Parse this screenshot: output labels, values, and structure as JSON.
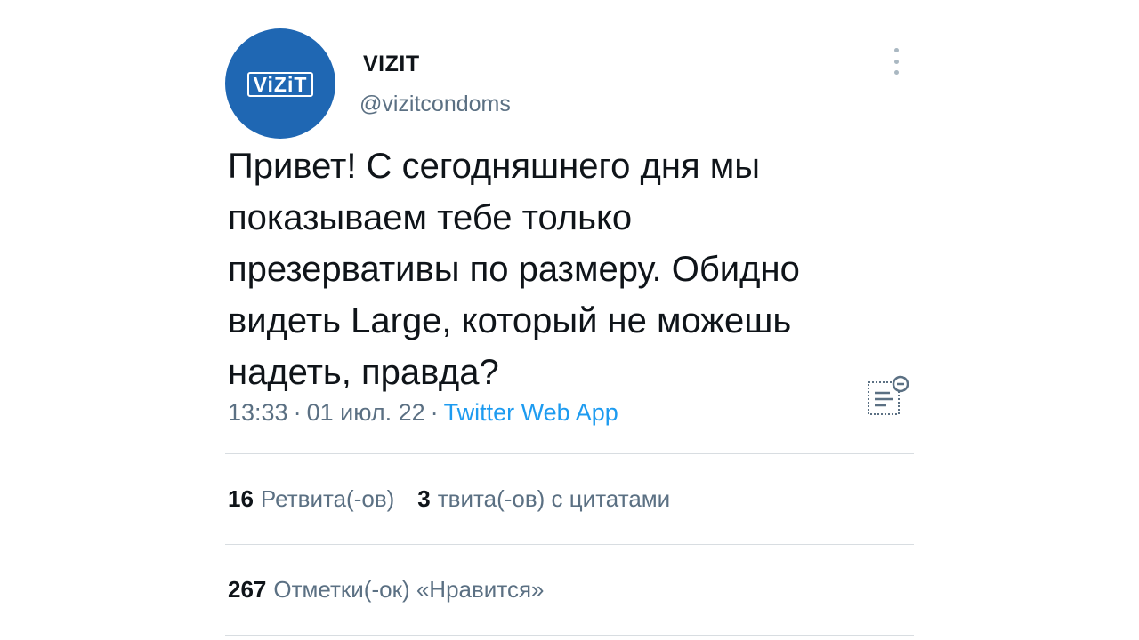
{
  "tweet": {
    "avatar_logo": "ViZiT",
    "display_name": "VIZIT",
    "handle": "@vizitcondoms",
    "text": "Привет! С сегодняшнего дня мы\nпоказываем тебе только\nпрезервативы по размеру. Обидно\nвидеть Large, который не можешь\nнадеть, правда?",
    "time": "13:33",
    "date": "01 июл. 22",
    "separator": "·",
    "source": "Twitter Web App",
    "more_icon": "more-vertical-icon",
    "translate_icon": "translate-icon"
  },
  "stats": {
    "retweets_count": "16",
    "retweets_label": "Ретвита(-ов)",
    "quotes_count": "3",
    "quotes_label": "твита(-ов) с цитатами",
    "likes_count": "267",
    "likes_label": "Отметки(-ок) «Нравится»"
  },
  "colors": {
    "avatar_bg": "#1f67b3",
    "link": "#1d9bf0",
    "secondary_text": "#5b7083",
    "primary_text": "#0f1419",
    "divider": "#d8dde1"
  }
}
